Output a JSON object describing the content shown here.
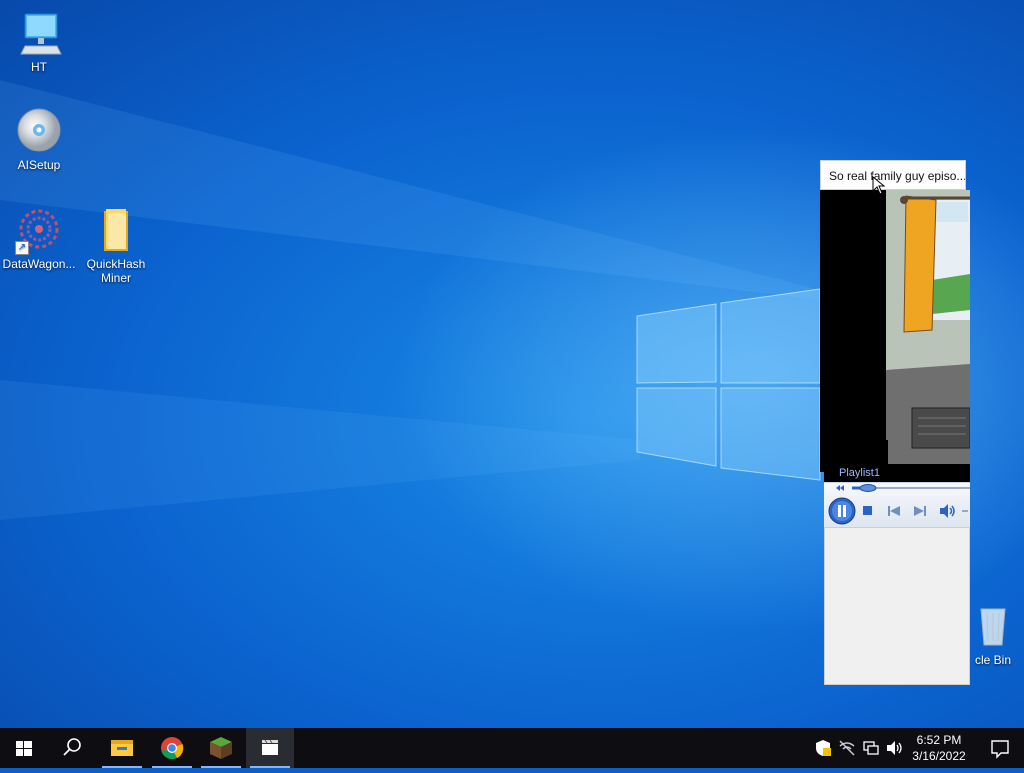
{
  "desktop": {
    "icons": [
      {
        "label": "HT",
        "icon": "computer-icon"
      },
      {
        "label": "AISetup",
        "icon": "disc-icon"
      },
      {
        "label": "DataWagon...",
        "icon": "datawagon-icon"
      },
      {
        "label": "QuickHash Miner",
        "icon": "folder-icon"
      },
      {
        "label": "cle Bin",
        "icon": "recycle-bin-icon"
      }
    ]
  },
  "media_player": {
    "title": "So real family guy episo...",
    "playlist_label": "Playlist1",
    "state": "playing",
    "colors": {
      "accent": "#2b63c6",
      "playlist_text": "#9fb6ff"
    }
  },
  "taskbar": {
    "buttons": [
      {
        "name": "start",
        "icon": "windows-logo-icon"
      },
      {
        "name": "search",
        "icon": "search-icon"
      },
      {
        "name": "file-explorer",
        "icon": "folder-icon"
      },
      {
        "name": "chrome",
        "icon": "chrome-icon"
      },
      {
        "name": "minecraft",
        "icon": "grass-block-icon"
      },
      {
        "name": "media-player",
        "icon": "clapper-icon"
      }
    ],
    "tray": [
      "security-icon",
      "network-warning-icon",
      "network-icon",
      "volume-icon"
    ],
    "clock": {
      "time": "6:52 PM",
      "date": "3/16/2022"
    },
    "colors": {
      "background": "#0d0d12",
      "open_indicator": "#8ab4f8"
    }
  }
}
